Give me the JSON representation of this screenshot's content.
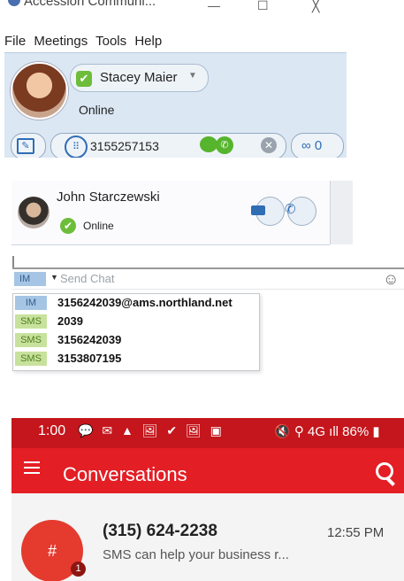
{
  "desktop": {
    "window_title": "Accession Communi...",
    "window_controls": {
      "minimize": "—",
      "maximize": "☐",
      "close": "╳"
    },
    "menu": [
      "File",
      "Meetings",
      "Tools",
      "Help"
    ],
    "user": {
      "name": "Stacey Maier",
      "status": "Online",
      "status_color": "#6dbd3a"
    },
    "dial_value": "3155257153",
    "voicemail_label": "∞ 0"
  },
  "contact": {
    "name": "John Starczewski",
    "status": "Online"
  },
  "chat": {
    "mode_tag": "IM",
    "placeholder": "Send Chat",
    "smiley": "☺",
    "options": [
      {
        "tag": "IM",
        "value": "3156242039@ams.northland.net"
      },
      {
        "tag": "SMS",
        "value": "2039"
      },
      {
        "tag": "SMS",
        "value": "3156242039"
      },
      {
        "tag": "SMS",
        "value": "3153807195"
      }
    ]
  },
  "phone": {
    "time": "1:00",
    "status_icons": "💬 ✉ ▲ 🖼 ✔ 🖼 ▣",
    "status_right": "🔇 ⚲ 4G ıll 86% ▮",
    "app_title": "Conversations",
    "accent": "#e31e25",
    "conversation": {
      "avatar_label": "#",
      "unread": "1",
      "name": "(315) 624-2238",
      "preview": "SMS can help your business r...",
      "time": "12:55 PM"
    }
  }
}
